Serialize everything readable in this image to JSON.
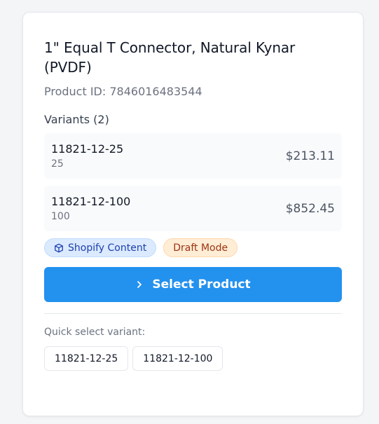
{
  "product": {
    "title": "1\" Equal T Connector, Natural Kynar (PVDF)",
    "id_text": "Product ID: 7846016483544"
  },
  "variants": {
    "heading": "Variants (2)",
    "items": [
      {
        "sku": "11821-12-25",
        "qty": "25",
        "price": "$213.11"
      },
      {
        "sku": "11821-12-100",
        "qty": "100",
        "price": "$852.45"
      }
    ]
  },
  "badges": {
    "shopify": {
      "label": "Shopify Content",
      "icon": "cube-icon"
    },
    "draft": {
      "label": "Draft Mode"
    }
  },
  "actions": {
    "select_label": "Select Product",
    "select_icon": "chevron-right-icon"
  },
  "quick_select": {
    "label": "Quick select variant:",
    "options": [
      "11821-12-25",
      "11821-12-100"
    ]
  },
  "colors": {
    "accent": "#2391ee",
    "badge_blue_bg": "#dbeafe",
    "badge_orange_bg": "#ffedd5"
  }
}
